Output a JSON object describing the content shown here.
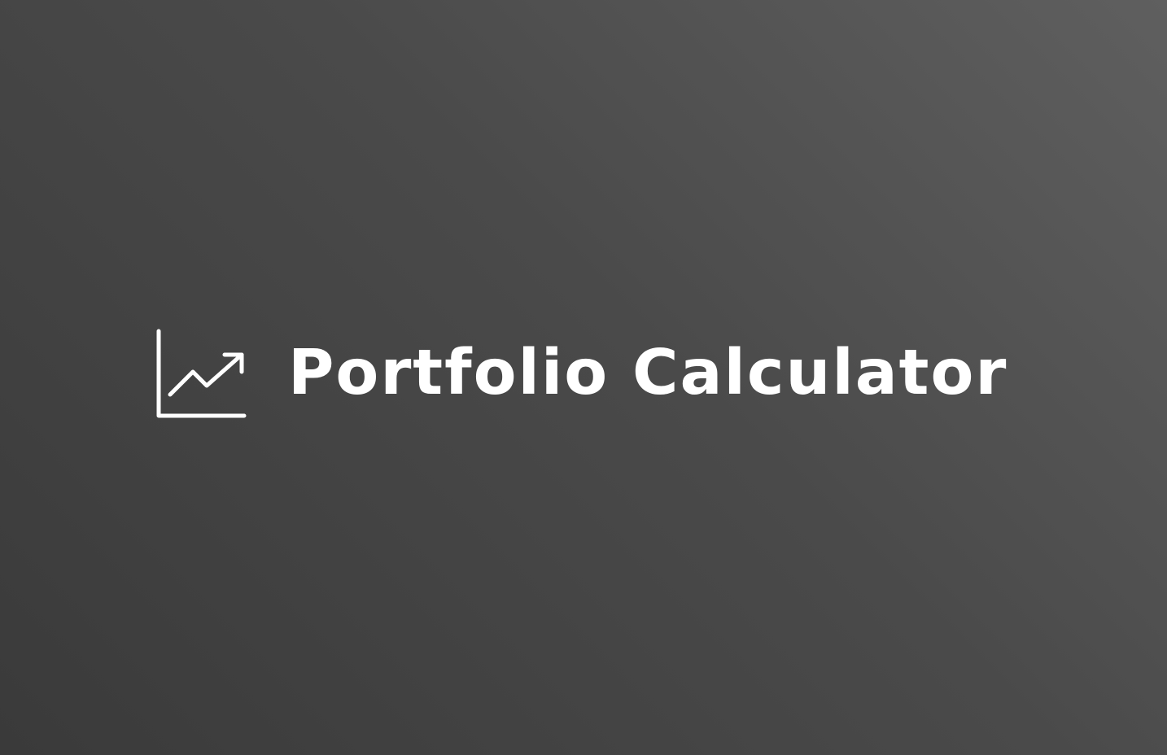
{
  "app": {
    "title": "Portfolio Calculator",
    "icon": "trending-up-chart-icon"
  },
  "colors": {
    "background_light": "#5f5f5f",
    "background_dark": "#3a3a3a",
    "foreground": "#ffffff"
  }
}
